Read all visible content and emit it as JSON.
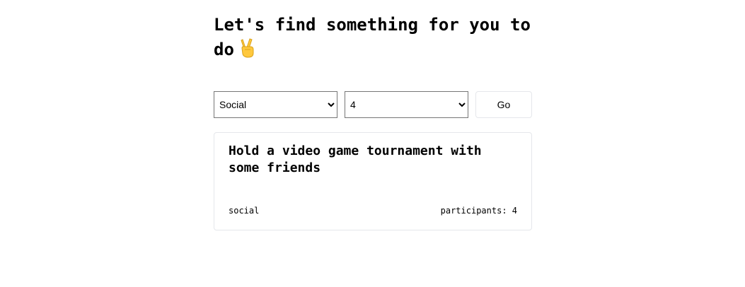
{
  "header": {
    "title": "Let's find something for you to do",
    "title_icon": "victory-hand-icon"
  },
  "filters": {
    "activity_type": {
      "selected": "Social",
      "options": [
        "Social"
      ]
    },
    "participants": {
      "selected": "4",
      "options": [
        "4"
      ]
    },
    "go_label": "Go"
  },
  "result": {
    "activity": "Hold a video game tournament with some friends",
    "type": "social",
    "participants_label": "participants: 4"
  },
  "colors": {
    "card_border": "#e5e7eb",
    "select_border": "#767676",
    "icon_fill": "#FFC83D"
  }
}
